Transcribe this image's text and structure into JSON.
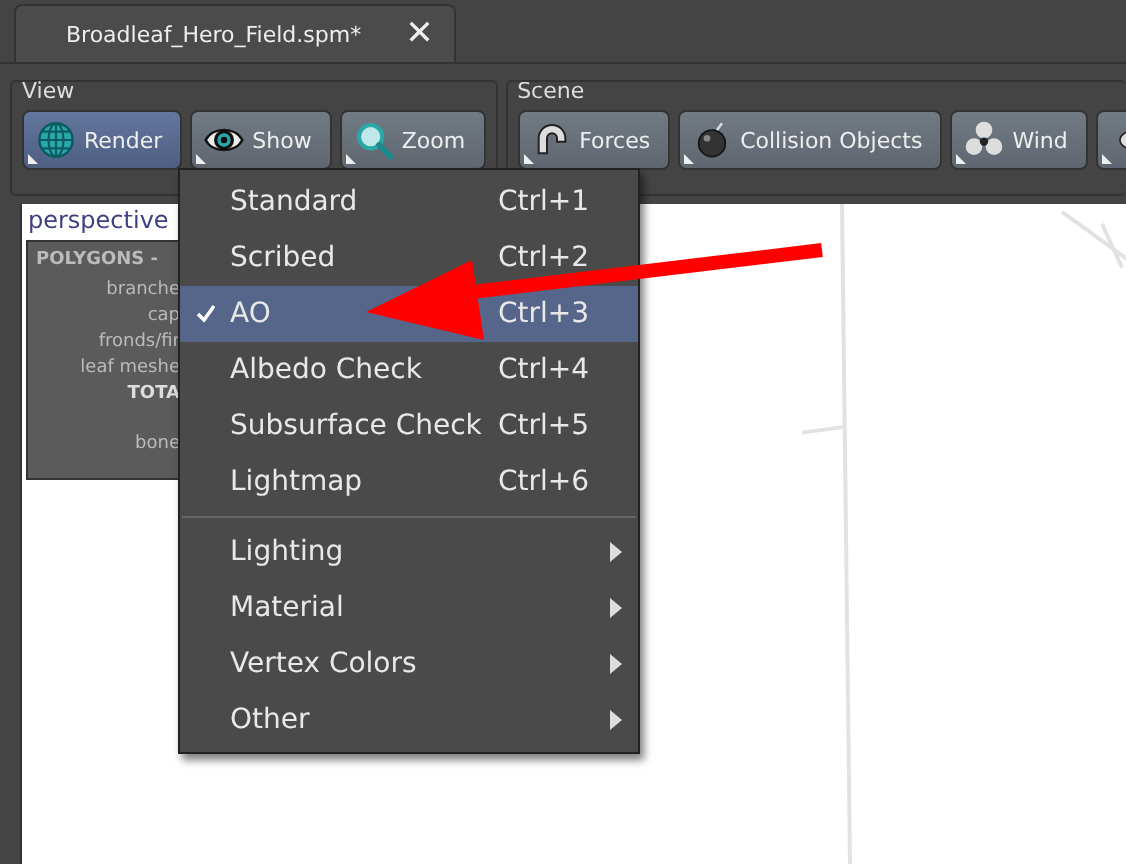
{
  "tab": {
    "title": "Broadleaf_Hero_Field.spm*",
    "close": "✕"
  },
  "toolbar_groups": [
    {
      "title": "View",
      "buttons": [
        {
          "label": "Render",
          "selected": true
        },
        {
          "label": "Show",
          "selected": false
        },
        {
          "label": "Zoom",
          "selected": false
        }
      ]
    },
    {
      "title": "Scene",
      "buttons": [
        {
          "label": "Forces",
          "selected": false
        },
        {
          "label": "Collision Objects",
          "selected": false
        },
        {
          "label": "Wind",
          "selected": false
        },
        {
          "selected": false
        }
      ]
    }
  ],
  "viewport": {
    "title": "perspective",
    "stats": {
      "heading": "POLYGONS -",
      "lines": [
        {
          "text": "branche",
          "bold": false
        },
        {
          "text": "cap",
          "bold": false
        },
        {
          "text": "fronds/fir",
          "bold": false
        },
        {
          "text": "leaf meshe",
          "bold": false
        },
        {
          "text": "TOTA",
          "bold": true
        },
        {
          "text": "bone",
          "bold": false
        }
      ]
    }
  },
  "menu": [
    {
      "kind": "item",
      "label": "Standard",
      "shortcut": "Ctrl+1",
      "checked": false,
      "selected": false
    },
    {
      "kind": "item",
      "label": "Scribed",
      "shortcut": "Ctrl+2",
      "checked": false,
      "selected": false
    },
    {
      "kind": "item",
      "label": "AO",
      "shortcut": "Ctrl+3",
      "checked": true,
      "selected": true
    },
    {
      "kind": "item",
      "label": "Albedo Check",
      "shortcut": "Ctrl+4",
      "checked": false,
      "selected": false
    },
    {
      "kind": "item",
      "label": "Subsurface Check",
      "shortcut": "Ctrl+5",
      "checked": false,
      "selected": false
    },
    {
      "kind": "item",
      "label": "Lightmap",
      "shortcut": "Ctrl+6",
      "checked": false,
      "selected": false
    },
    {
      "kind": "separator"
    },
    {
      "kind": "submenu",
      "label": "Lighting",
      "checked": false,
      "selected": false
    },
    {
      "kind": "submenu",
      "label": "Material",
      "checked": false,
      "selected": false
    },
    {
      "kind": "submenu",
      "label": "Vertex Colors",
      "checked": false,
      "selected": false
    },
    {
      "kind": "submenu",
      "label": "Other",
      "checked": false,
      "selected": false
    }
  ]
}
